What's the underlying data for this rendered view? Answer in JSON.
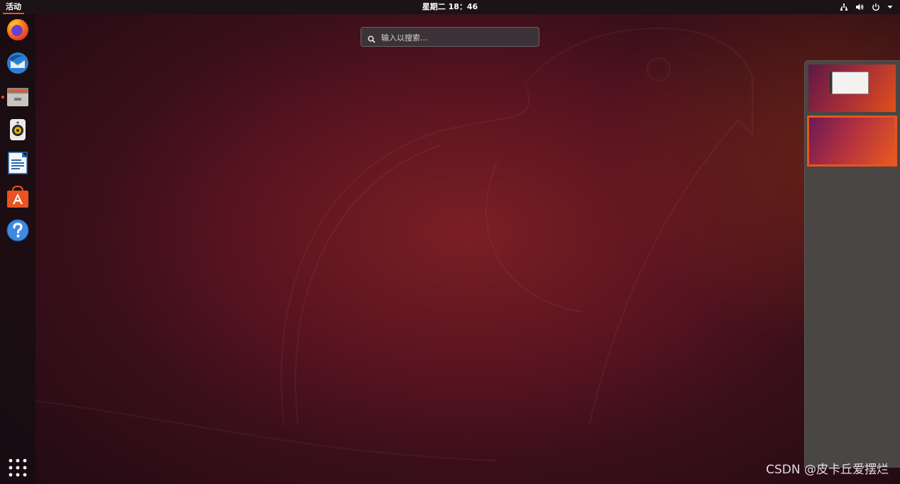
{
  "topbar": {
    "activities_label": "活动",
    "clock": "星期二 18：46"
  },
  "search": {
    "placeholder": "输入以搜索..."
  },
  "dock": {
    "items": [
      {
        "name": "firefox",
        "icon": "firefox-icon"
      },
      {
        "name": "thunderbird",
        "icon": "thunderbird-icon"
      },
      {
        "name": "files",
        "icon": "files-icon",
        "running": true
      },
      {
        "name": "rhythmbox",
        "icon": "rhythmbox-icon"
      },
      {
        "name": "libreoffice-writer",
        "icon": "writer-icon"
      },
      {
        "name": "ubuntu-software",
        "icon": "software-icon"
      },
      {
        "name": "help",
        "icon": "help-icon"
      }
    ],
    "show_apps_icon": "app-grid-icon"
  },
  "workspaces": {
    "count": 2,
    "active_index": 1
  },
  "watermark": "CSDN @皮卡丘爱摆烂",
  "colors": {
    "accent": "#e95420",
    "topbar": "#1b1316",
    "panel": "#4a4643"
  }
}
